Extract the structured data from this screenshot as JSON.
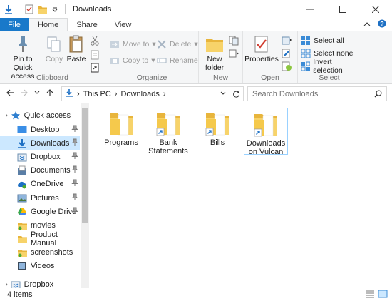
{
  "window": {
    "title": "Downloads"
  },
  "tabs": {
    "file": "File",
    "home": "Home",
    "share": "Share",
    "view": "View"
  },
  "ribbon": {
    "clipboard": {
      "label": "Clipboard",
      "pin": "Pin to Quick access",
      "copy": "Copy",
      "paste": "Paste"
    },
    "organize": {
      "label": "Organize",
      "move_to": "Move to",
      "copy_to": "Copy to",
      "delete": "Delete",
      "rename": "Rename"
    },
    "new": {
      "label": "New",
      "new_folder": "New folder"
    },
    "open": {
      "label": "Open",
      "properties": "Properties"
    },
    "select": {
      "label": "Select",
      "select_all": "Select all",
      "select_none": "Select none",
      "invert": "Invert selection"
    }
  },
  "address": {
    "crumbs": [
      "This PC",
      "Downloads"
    ]
  },
  "search": {
    "placeholder": "Search Downloads"
  },
  "nav": {
    "items": [
      {
        "label": "Quick access",
        "icon": "star-icon"
      },
      {
        "label": "Desktop",
        "icon": "desktop-icon"
      },
      {
        "label": "Downloads",
        "icon": "download-icon"
      },
      {
        "label": "Dropbox",
        "icon": "dropbox-icon"
      },
      {
        "label": "Documents",
        "icon": "documents-icon"
      },
      {
        "label": "OneDrive",
        "icon": "onedrive-icon"
      },
      {
        "label": "Pictures",
        "icon": "pictures-icon"
      },
      {
        "label": "Google Drive",
        "icon": "google-drive-icon"
      },
      {
        "label": "movies",
        "icon": "folder-icon"
      },
      {
        "label": "Product Manual",
        "icon": "folder-icon"
      },
      {
        "label": "screenshots",
        "icon": "folder-icon"
      },
      {
        "label": "Videos",
        "icon": "videos-icon"
      },
      {
        "label": "Dropbox",
        "icon": "dropbox-icon"
      }
    ]
  },
  "files": [
    {
      "name": "Programs",
      "shortcut": false
    },
    {
      "name": "Bank Statements",
      "shortcut": true
    },
    {
      "name": "Bills",
      "shortcut": true
    },
    {
      "name": "Downloads on Vulcan",
      "shortcut": true
    }
  ],
  "status": {
    "count": "4 items"
  },
  "colors": {
    "accent": "#1979ca",
    "selection": "#cce8ff",
    "folder": "#f2c54a"
  }
}
